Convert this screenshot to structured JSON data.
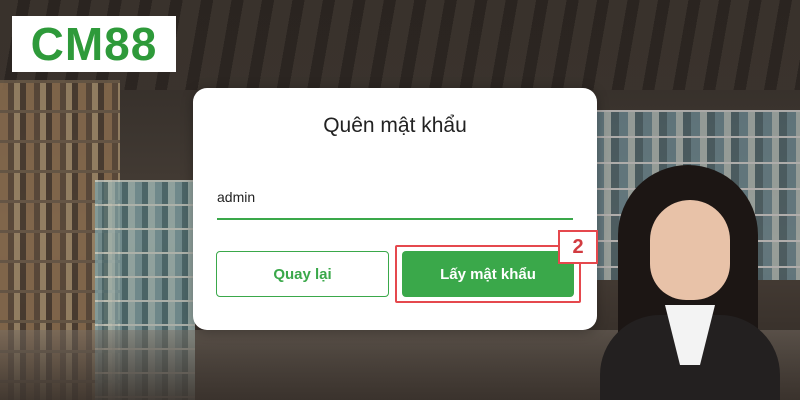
{
  "logo": {
    "text": "CM88"
  },
  "dialog": {
    "title": "Quên mật khẩu",
    "username_value": "admin",
    "back_label": "Quay lại",
    "submit_label": "Lấy mật khẩu"
  },
  "annotation": {
    "step": "2"
  },
  "colors": {
    "brand_green": "#3aa84a",
    "highlight_red": "#e5484d"
  }
}
